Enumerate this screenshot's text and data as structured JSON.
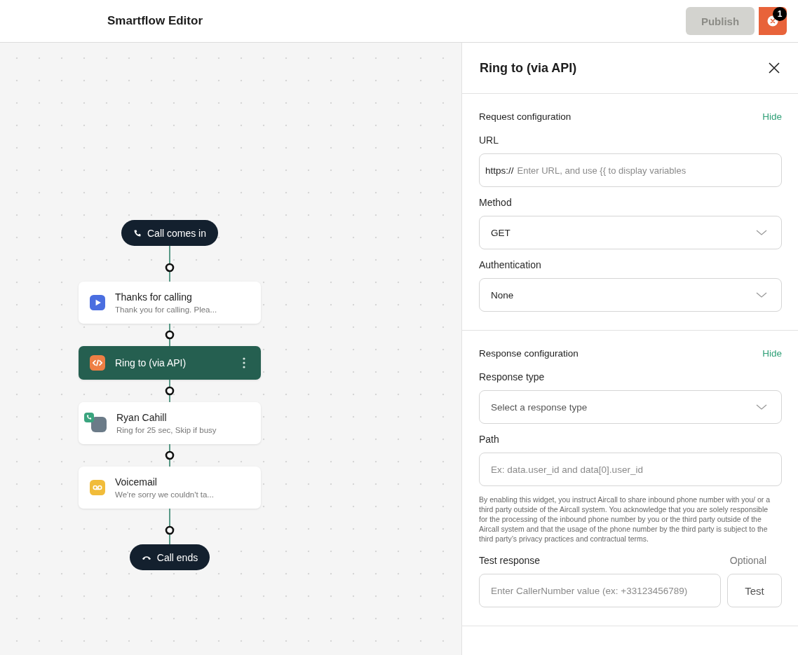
{
  "header": {
    "title": "Smartflow Editor",
    "publish_button": {
      "label": "Publish",
      "disabled": true
    },
    "errors_button": {
      "badge": "1"
    }
  },
  "flow": [
    {
      "kind": "start",
      "label": "Call comes in"
    },
    {
      "kind": "prompt",
      "title": "Thanks for calling",
      "subtitle": "Thank you for calling. Plea...",
      "selected": false
    },
    {
      "kind": "api",
      "title": "Ring to (via API)",
      "selected": true
    },
    {
      "kind": "user",
      "title": "Ryan Cahill",
      "subtitle": "Ring for 25 sec, Skip if busy",
      "selected": false
    },
    {
      "kind": "voicemail",
      "title": "Voicemail",
      "subtitle": "We're sorry we couldn't ta...",
      "selected": false
    },
    {
      "kind": "end",
      "label": "Call ends"
    }
  ],
  "panel": {
    "title": "Ring to (via API)",
    "sections": [
      {
        "title": "Request configuration",
        "toggle": "Hide",
        "fields": [
          {
            "kind": "url",
            "label": "URL",
            "prefix": "https://",
            "placeholder": "Enter URL, and use {{ to display variables"
          },
          {
            "kind": "select",
            "label": "Method",
            "value": "GET"
          },
          {
            "kind": "select",
            "label": "Authentication",
            "value": "None"
          }
        ]
      },
      {
        "title": "Response configuration",
        "toggle": "Hide",
        "fields": [
          {
            "kind": "select",
            "label": "Response type",
            "placeholder": "Select a response type"
          },
          {
            "kind": "text",
            "label": "Path",
            "placeholder": "Ex: data.user_id and data[0].user_id"
          },
          {
            "kind": "note",
            "text": "By enabling this widget, you instruct Aircall to share inbound phone number with you/ or a third party outside of the Aircall system. You acknowledge that you are solely responsible for the processing of the inbound phone number by you or the third party outside of the Aircall system and that the usage of the phone number by the third party is subject to the third party’s privacy practices and contractual terms."
          },
          {
            "kind": "test",
            "label": "Test response",
            "hint": "Optional",
            "placeholder": "Enter CallerNumber value (ex: +33123456789)",
            "button": "Test"
          }
        ]
      }
    ]
  }
}
